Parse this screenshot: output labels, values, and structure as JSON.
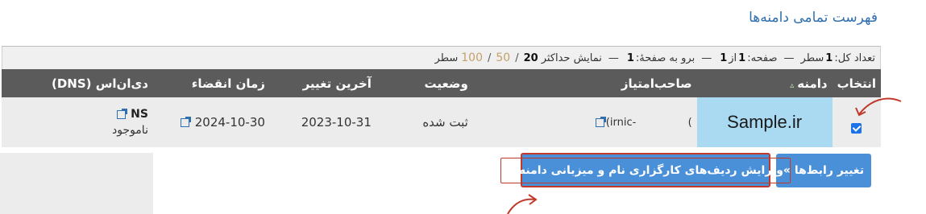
{
  "page_title": "فهرست تمامی دامنه‌ها",
  "info_bar": {
    "total_label": "تعداد کل:",
    "total_value": "1",
    "row_word": "سطر",
    "page_label": "صفحه:",
    "page_current": "1",
    "of_word": "از",
    "page_total": "1",
    "goto_label": "برو به صفحهٔ:",
    "goto_value": "1",
    "show_max_label": "نمایش حداکثر",
    "limit_20": "20",
    "limit_50": "50",
    "limit_100": "100",
    "rows_suffix": "سطر",
    "dash": "—",
    "slash": "/"
  },
  "table": {
    "headers": {
      "select": "انتخاب",
      "domain": "دامنه",
      "holder": "صاحب‌امتیاز",
      "status": "وضعیت",
      "last_change": "آخرین تغییر",
      "expiry": "زمان انقضاء",
      "dns": "دی‌ان‌اس (DNS)"
    },
    "sort_indicator": "▵",
    "rows": [
      {
        "selected": true,
        "domain": "Sample.ir",
        "holder_handle": "-irnic)",
        "holder_close": ")",
        "status": "ثبت شده",
        "last_change": "2023-10-31",
        "expiry": "2024-10-30",
        "dns_label": "NS",
        "dns_value": "ناموجود"
      }
    ]
  },
  "buttons": {
    "change_links": "تغییر رابط‌ها »",
    "edit_records": "ویرایش ردیف‌های کارگزاری نام و میزبانی دامنه »"
  },
  "colors": {
    "header_bg": "#5b5b5b",
    "row_bg": "#ececec",
    "domain_highlight": "#a9daf2",
    "button_bg": "#4a90d9",
    "annotation": "#c0392b",
    "title_color": "#2f6fae"
  },
  "icons": [
    "external-link-icon",
    "checkbox-checked-icon",
    "sort-up-icon",
    "annotation-arrow-icon"
  ]
}
